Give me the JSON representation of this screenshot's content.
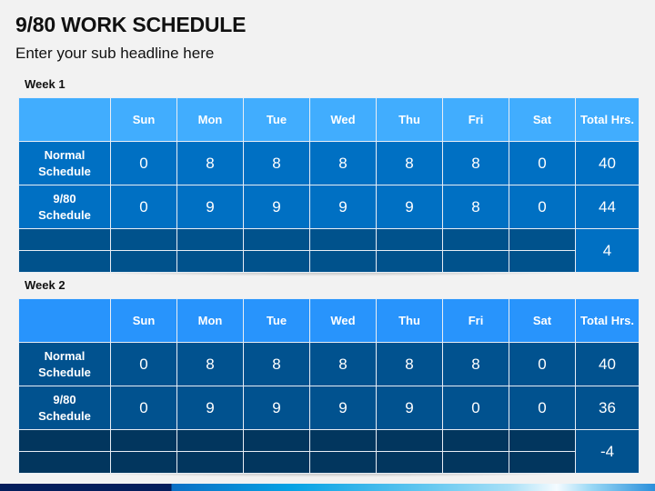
{
  "header": {
    "title": "9/80 WORK SCHEDULE",
    "subtitle": "Enter your sub headline here"
  },
  "columns": [
    "",
    "Sun",
    "Mon",
    "Tue",
    "Wed",
    "Thu",
    "Fri",
    "Sat",
    "Total Hrs."
  ],
  "weeks": [
    {
      "label": "Week 1",
      "rows": [
        {
          "label": "Normal Schedule",
          "values": [
            "0",
            "8",
            "8",
            "8",
            "8",
            "8",
            "0"
          ],
          "total": "40"
        },
        {
          "label": "9/80 Schedule",
          "values": [
            "0",
            "9",
            "9",
            "9",
            "9",
            "8",
            "0"
          ],
          "total": "44"
        }
      ],
      "difference": "4"
    },
    {
      "label": "Week 2",
      "rows": [
        {
          "label": "Normal Schedule",
          "values": [
            "0",
            "8",
            "8",
            "8",
            "8",
            "8",
            "0"
          ],
          "total": "40"
        },
        {
          "label": "9/80 Schedule",
          "values": [
            "0",
            "9",
            "9",
            "9",
            "9",
            "0",
            "0"
          ],
          "total": "36"
        }
      ],
      "difference": "-4"
    }
  ],
  "colors": {
    "week1_header": "#41adfe",
    "week1_cells": "#0070c3",
    "week1_blank": "#00528c",
    "week2_header": "#2894fc",
    "week2_cells": "#01528f",
    "week2_blank": "#02365e"
  }
}
